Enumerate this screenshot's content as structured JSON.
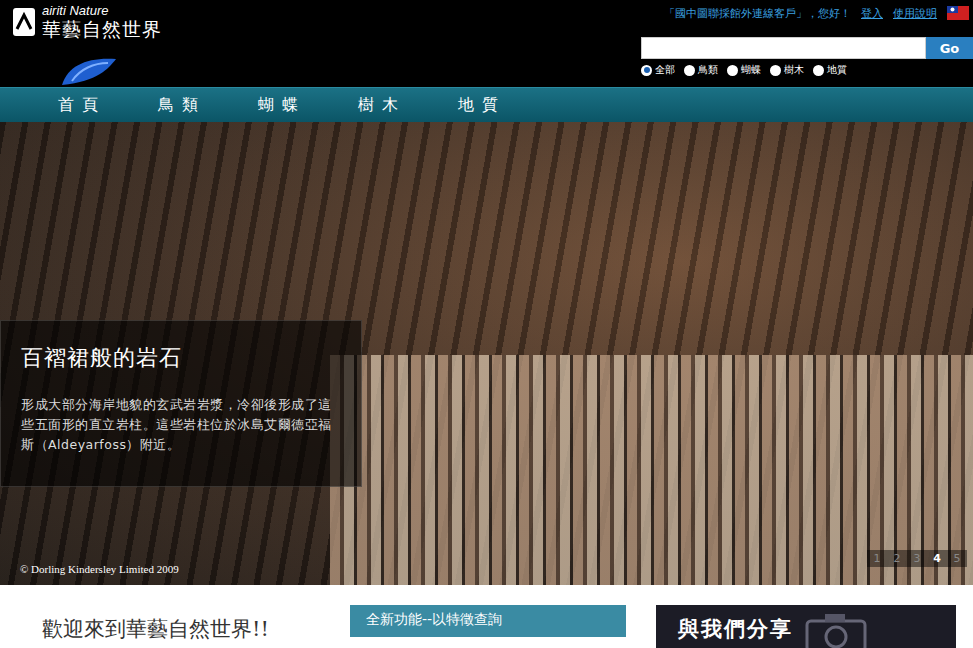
{
  "logo": {
    "brand": "airiti Nature",
    "name": "華藝自然世界"
  },
  "user_bar": {
    "greeting": "「國中圖聯採館外連線客戶」，您好！",
    "links": [
      "登入",
      "使用說明"
    ]
  },
  "search": {
    "button": "Go",
    "scopes": [
      {
        "label": "全部",
        "selected": true
      },
      {
        "label": "鳥類",
        "selected": false
      },
      {
        "label": "蝴蝶",
        "selected": false
      },
      {
        "label": "樹木",
        "selected": false
      },
      {
        "label": "地質",
        "selected": false
      }
    ]
  },
  "nav": [
    "首頁",
    "鳥類",
    "蝴蝶",
    "樹木",
    "地質"
  ],
  "hero": {
    "title": "百褶裙般的岩石",
    "text": "形成大部分海岸地貌的玄武岩岩漿，冷卻後形成了這些五面形的直立岩柱。這些岩柱位於冰島艾爾德亞福斯（Aldeyarfoss）附近。",
    "credit": "© Dorling Kindersley Limited 2009",
    "pages": [
      {
        "label": "1",
        "selected": false
      },
      {
        "label": "2",
        "selected": false
      },
      {
        "label": "3",
        "selected": false
      },
      {
        "label": "4",
        "selected": true
      },
      {
        "label": "5",
        "selected": false
      }
    ]
  },
  "sections": {
    "welcome": "歡迎來到華藝自然世界!!",
    "feature": "全新功能--以特徵查詢",
    "share": "與我們分享"
  }
}
